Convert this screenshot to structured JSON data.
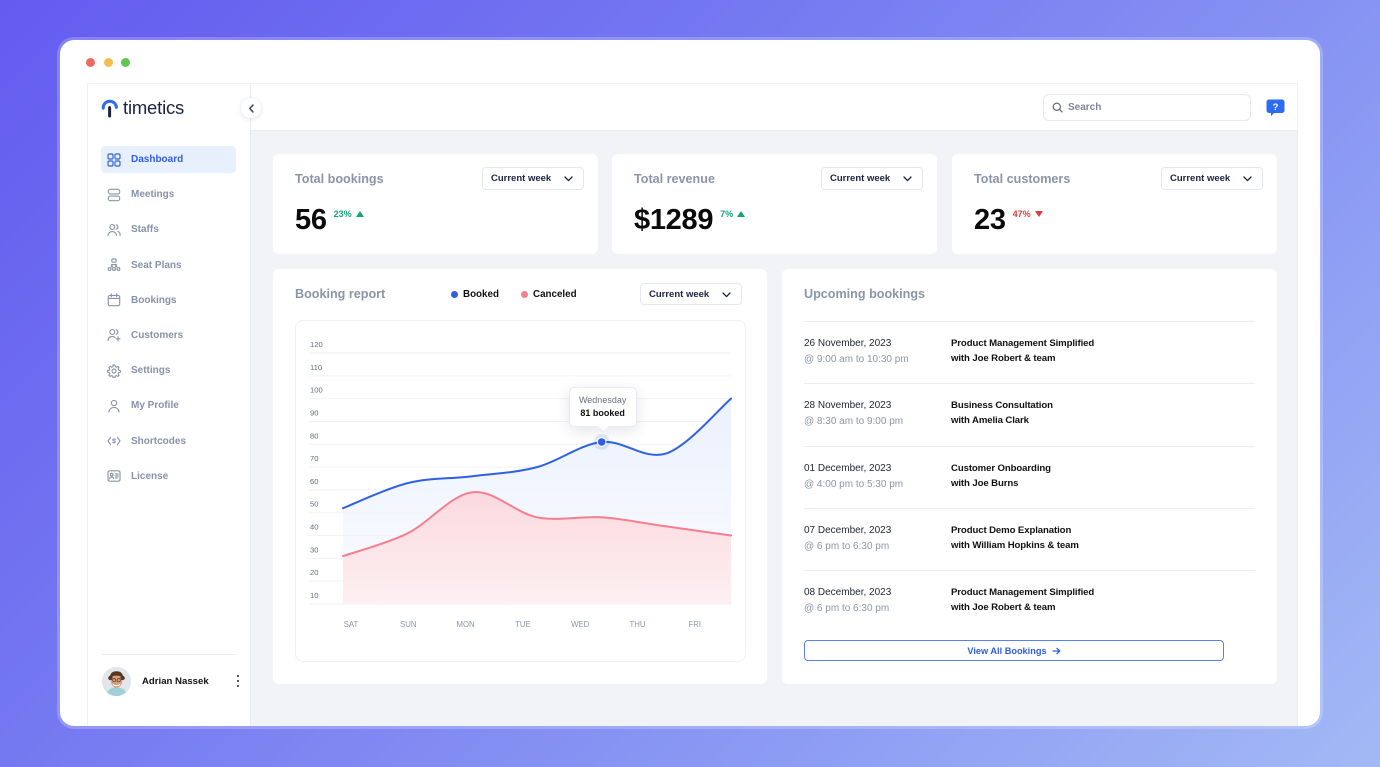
{
  "window": {
    "controls": [
      "close",
      "minimize",
      "maximize"
    ]
  },
  "brand": {
    "name": "timetics"
  },
  "colors": {
    "accent": "#2f5fe0",
    "positive": "#12a37a",
    "negative": "#e5383b",
    "booked": "#3060e2",
    "canceled": "#f47f8f",
    "help": "#2f6bf0"
  },
  "sidebar": {
    "items": [
      {
        "label": "Dashboard",
        "icon": "dashboard-icon",
        "active": true
      },
      {
        "label": "Meetings",
        "icon": "meetings-icon",
        "active": false
      },
      {
        "label": "Staffs",
        "icon": "staffs-icon",
        "active": false
      },
      {
        "label": "Seat Plans",
        "icon": "seat-plans-icon",
        "active": false
      },
      {
        "label": "Bookings",
        "icon": "calendar-icon",
        "active": false
      },
      {
        "label": "Customers",
        "icon": "add-user-icon",
        "active": false
      },
      {
        "label": "Settings",
        "icon": "gear-icon",
        "active": false
      },
      {
        "label": "My Profile",
        "icon": "user-icon",
        "active": false
      },
      {
        "label": "Shortcodes",
        "icon": "shortcode-icon",
        "active": false
      },
      {
        "label": "License",
        "icon": "id-card-icon",
        "active": false
      }
    ],
    "user": {
      "name": "Adrian Nassek"
    }
  },
  "topbar": {
    "search_placeholder": "Search",
    "help_icon": "help-icon"
  },
  "stats": [
    {
      "title": "Total bookings",
      "period": "Current week",
      "value": "56",
      "change": "23%",
      "trend": "up"
    },
    {
      "title": "Total revenue",
      "period": "Current week",
      "value": "$1289",
      "change": "7%",
      "trend": "up"
    },
    {
      "title": "Total customers",
      "period": "Current week",
      "value": "23",
      "change": "47%",
      "trend": "down"
    }
  ],
  "booking_report": {
    "title": "Booking report",
    "period": "Current week",
    "legend": [
      {
        "label": "Booked"
      },
      {
        "label": "Canceled"
      }
    ]
  },
  "chart_data": {
    "type": "line",
    "title": "Booking report",
    "xlabel": "",
    "ylabel": "",
    "x": [
      "SAT",
      "SUN",
      "MON",
      "TUE",
      "WED",
      "THU",
      "FRI"
    ],
    "series": [
      {
        "name": "Booked",
        "color": "#3060e2",
        "values": [
          52,
          63,
          66,
          70,
          81,
          76,
          100
        ]
      },
      {
        "name": "Canceled",
        "color": "#f47f8f",
        "values": [
          31,
          41,
          59,
          48,
          48,
          44,
          40
        ]
      }
    ],
    "ylim": [
      10,
      120
    ],
    "y_ticks": [
      10,
      20,
      30,
      40,
      50,
      60,
      70,
      80,
      90,
      100,
      110,
      120
    ],
    "grid": true,
    "area_fill": true,
    "legend": "top",
    "tooltip": {
      "category": "WED",
      "title": "Wednesday",
      "text": "81 booked"
    }
  },
  "upcoming": {
    "title": "Upcoming bookings",
    "items": [
      {
        "date": "26 November, 2023",
        "time": "@ 9:00 am to 10:30 pm",
        "title": "Product Management Simplified",
        "with": "with Joe Robert & team"
      },
      {
        "date": "28 November, 2023",
        "time": "@ 8:30 am to 9:00 pm",
        "title": "Business Consultation",
        "with": "with Amelia Clark"
      },
      {
        "date": "01 December, 2023",
        "time": "@ 4:00 pm to 5:30 pm",
        "title": "Customer Onboarding",
        "with": "with Joe Burns"
      },
      {
        "date": "07 December, 2023",
        "time": "@ 6 pm to 6:30 pm",
        "title": "Product Demo Explanation",
        "with": "with William Hopkins & team"
      },
      {
        "date": "08 December, 2023",
        "time": "@ 6 pm to 6:30 pm",
        "title": "Product Management Simplified",
        "with": "with Joe Robert & team"
      }
    ],
    "view_all": "View All Bookings"
  }
}
